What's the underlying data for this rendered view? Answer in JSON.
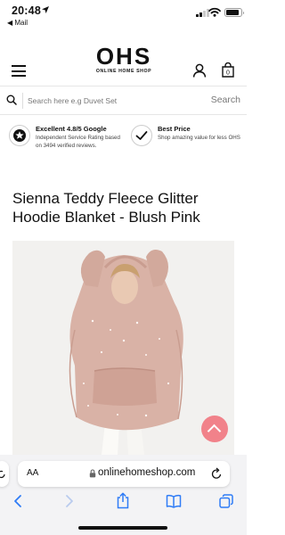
{
  "status_bar": {
    "time": "20:48",
    "back_app": "◀ Mail",
    "battery_level": 0.85
  },
  "header": {
    "logo_text": "OHS",
    "logo_subtitle": "ONLINE HOME SHOP",
    "basket_count": "0"
  },
  "search": {
    "placeholder": "Search here e.g Duvet Set",
    "button_label": "Search"
  },
  "trust": [
    {
      "title": "Excellent 4.8/5 Google",
      "description": "Independent Service Rating based on 3494 verified reviews.",
      "icon": "google-rating-icon"
    },
    {
      "title": "Best Price",
      "description": "Shop amazing value for less OHS",
      "icon": "checkmark-icon"
    }
  ],
  "product": {
    "title": "Sienna Teddy Fleece Glitter Hoodie Blanket - Blush Pink",
    "accent_color": "#f1828a",
    "image_colors": {
      "fleece": "#d9b2a6",
      "background": "#f2f1ef"
    }
  },
  "browser": {
    "text_size_label": "AA",
    "url": "onlinehomeshop.com"
  }
}
